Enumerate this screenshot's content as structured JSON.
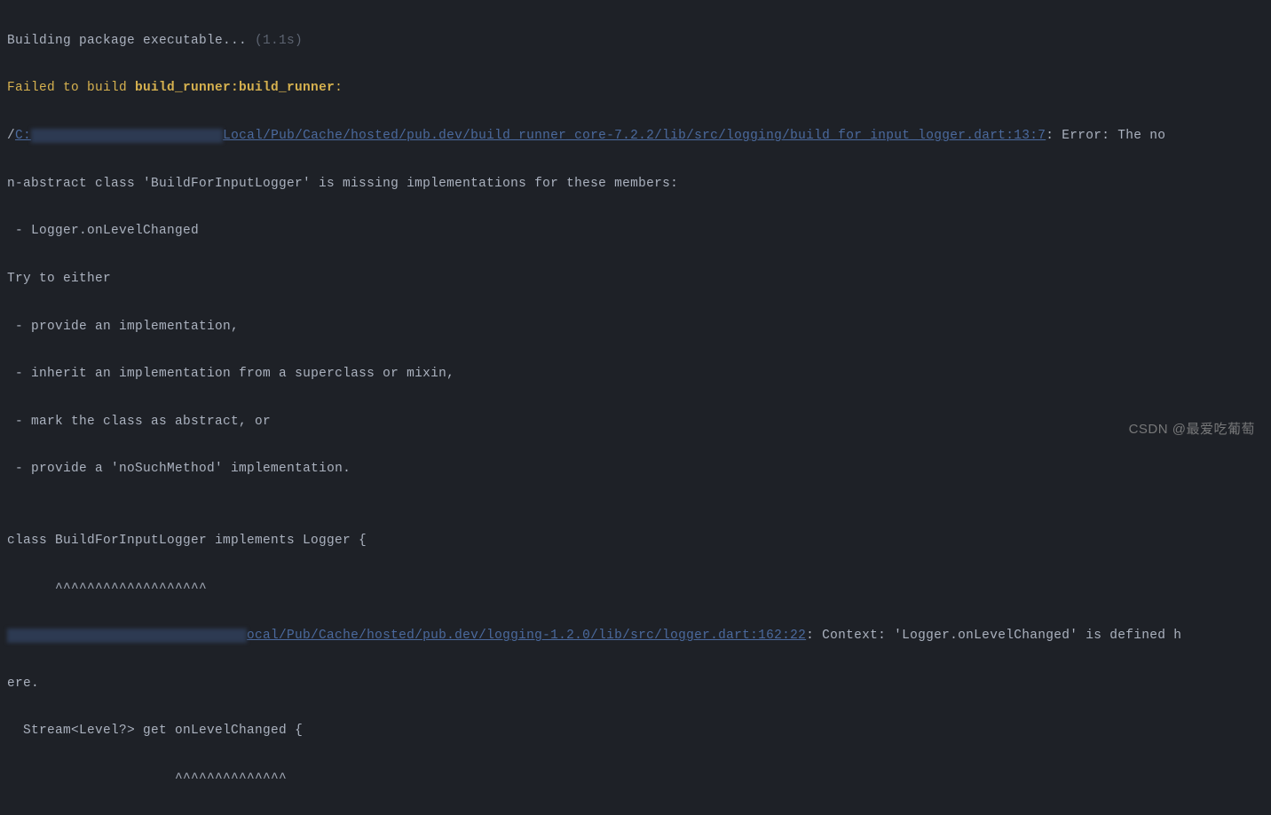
{
  "lines": {
    "l1_text": "Building package executable... ",
    "l1_time": "(1.1s)",
    "l2_prefix": "Failed to build ",
    "l2_target": "build_runner:build_runner",
    "l2_colon": ":",
    "l3_slash": "/",
    "l3_drive": "C:",
    "l3_redacted": "████████████████████████",
    "l3_path": "Local/Pub/Cache/hosted/pub.dev/build_runner_core-7.2.2/lib/src/logging/build_for_input_logger.dart:13:7",
    "l3_after": ": Error: The no",
    "l4": "n-abstract class 'BuildForInputLogger' is missing implementations for these members:",
    "l5": " - Logger.onLevelChanged",
    "l6": "Try to either",
    "l7": " - provide an implementation,",
    "l8": " - inherit an implementation from a superclass or mixin,",
    "l9": " - mark the class as abstract, or",
    "l10": " - provide a 'noSuchMethod' implementation.",
    "l11": "",
    "l12": "class BuildForInputLogger implements Logger {",
    "l13": "      ^^^^^^^^^^^^^^^^^^^",
    "l14_redacted": "██████████████████████████████",
    "l14_path": "ocal/Pub/Cache/hosted/pub.dev/logging-1.2.0/lib/src/logger.dart:162:22",
    "l14_after": ": Context: 'Logger.onLevelChanged' is defined h",
    "l15": "ere.",
    "l16": "  Stream<Level?> get onLevelChanged {",
    "l17": "                     ^^^^^^^^^^^^^^"
  },
  "watermark": "CSDN @最爱吃葡萄"
}
